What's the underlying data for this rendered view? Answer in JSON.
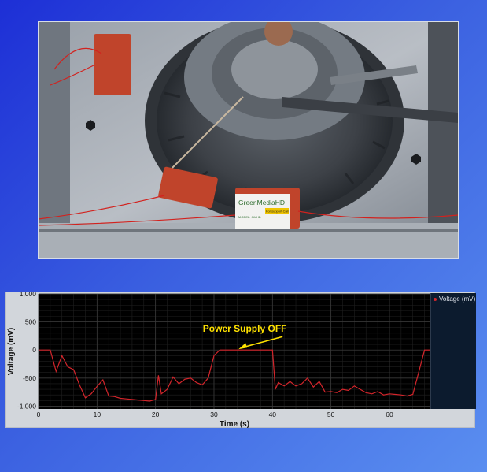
{
  "photo": {
    "label_brand": "GreenMediaHD",
    "label_model": "MODEL: GMHD",
    "label_support": "For support Call"
  },
  "chart_data": {
    "type": "line",
    "xlabel": "Time (s)",
    "ylabel": "Voltage (mV)",
    "xlim": [
      0,
      67
    ],
    "ylim": [
      -1050,
      1000
    ],
    "x_ticks": [
      0,
      10,
      20,
      30,
      40,
      50,
      60
    ],
    "y_ticks": [
      1000,
      500,
      0,
      -500,
      -1000
    ],
    "y_tick_labels": [
      "1,000",
      "500",
      "0",
      "-500",
      "-1,000"
    ],
    "grid": true,
    "legend_position": "right",
    "annotation": {
      "text": "Power Supply OFF",
      "x": 35,
      "y": 0
    },
    "series": [
      {
        "name": "Voltage (mV)",
        "color": "#d2252b",
        "x": [
          0,
          2,
          3,
          4,
          5,
          6,
          7,
          8,
          9,
          10,
          11,
          12,
          13,
          14,
          15,
          16,
          17,
          18,
          19,
          20,
          20.5,
          21,
          22,
          23,
          24,
          25,
          26,
          27,
          28,
          29,
          30,
          31,
          32,
          33,
          34,
          35,
          36,
          37,
          38,
          39,
          40,
          40.5,
          41,
          42,
          43,
          44,
          45,
          46,
          47,
          48,
          49,
          50,
          51,
          52,
          53,
          54,
          55,
          56,
          57,
          58,
          59,
          60,
          61,
          62,
          63,
          64,
          65,
          66,
          67
        ],
        "y": [
          0,
          0,
          -380,
          -100,
          -300,
          -350,
          -620,
          -850,
          -780,
          -650,
          -530,
          -820,
          -830,
          -860,
          -870,
          -880,
          -890,
          -900,
          -910,
          -880,
          -450,
          -780,
          -700,
          -480,
          -600,
          -520,
          -500,
          -580,
          -620,
          -500,
          -100,
          0,
          0,
          0,
          0,
          0,
          0,
          0,
          0,
          0,
          0,
          -700,
          -580,
          -640,
          -560,
          -640,
          -600,
          -500,
          -660,
          -560,
          -750,
          -740,
          -760,
          -700,
          -720,
          -640,
          -700,
          -760,
          -780,
          -740,
          -800,
          -780,
          -790,
          -800,
          -820,
          -790,
          -400,
          0,
          0
        ]
      }
    ]
  }
}
